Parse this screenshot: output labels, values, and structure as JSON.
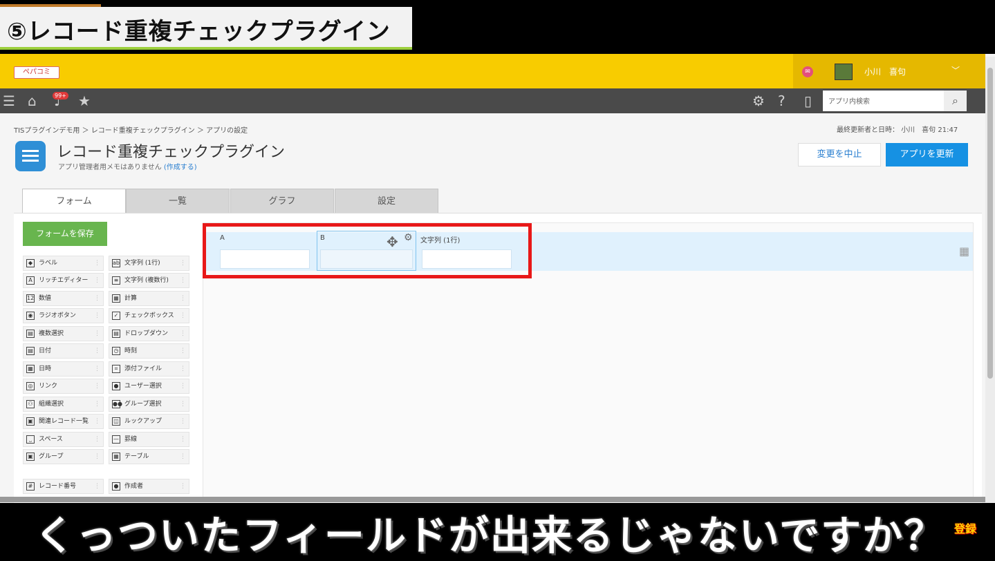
{
  "overlay": {
    "title": "⑤レコード重複チェックプラグイン"
  },
  "header": {
    "logo_text": "ペパコミ",
    "user_name": "小川　喜句",
    "notification_badge": "99+",
    "search_placeholder": "アプリ内検索",
    "brand_color": "#f8cc00"
  },
  "breadcrumb": {
    "items": [
      "TISプラグインデモ用",
      ">",
      "レコード重複チェックプラグイン",
      ">",
      "アプリの設定"
    ],
    "text": "TISプラグインデモ用 ＞ レコード重複チェックプラグイン ＞ アプリの設定"
  },
  "last_updated": {
    "label": "最終更新者と日時：",
    "user": "小川　喜句",
    "time": "21:47"
  },
  "page": {
    "title": "レコード重複チェックプラグイン",
    "memo": "アプリ管理者用メモはありません",
    "memo_link": "(作成する)",
    "cancel_label": "変更を中止",
    "update_label": "アプリを更新"
  },
  "tabs": [
    "フォーム",
    "一覧",
    "グラフ",
    "設定"
  ],
  "form": {
    "save_label": "フォームを保存",
    "palette_left": [
      "ラベル",
      "リッチエディター",
      "数値",
      "ラジオボタン",
      "複数選択",
      "日付",
      "日時",
      "リンク",
      "組織選択",
      "関連レコード一覧",
      "スペース",
      "グループ",
      "レコード番号"
    ],
    "palette_right": [
      "文字列 (1行)",
      "文字列 (複数行)",
      "計算",
      "チェックボックス",
      "ドロップダウン",
      "時刻",
      "添付ファイル",
      "ユーザー選択",
      "グループ選択",
      "ルックアップ",
      "罫線",
      "テーブル",
      "作成者"
    ],
    "fields": [
      {
        "label": "A",
        "value": ""
      },
      {
        "label": "B",
        "value": ""
      },
      {
        "label": "文字列 (1行)",
        "value": ""
      }
    ]
  },
  "subtitle": {
    "text": "くっついたフィールドが出来るじゃないですか？",
    "subscribe": "登録"
  },
  "icons": [
    "menu-icon",
    "home-icon",
    "bell-icon",
    "star-icon",
    "gear-icon",
    "help-icon",
    "mobile-icon",
    "search-icon",
    "mail-icon",
    "move-icon",
    "grid-icon"
  ]
}
